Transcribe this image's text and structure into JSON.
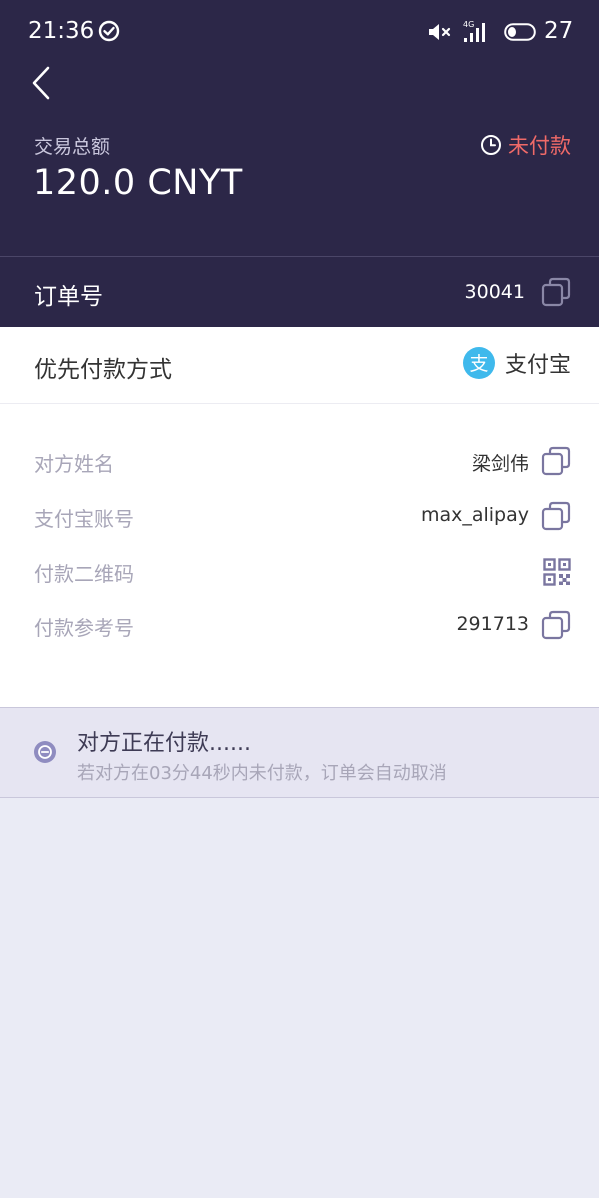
{
  "status_bar": {
    "time": "21:36",
    "battery": "27",
    "network": "4G"
  },
  "header": {
    "total_label": "交易总额",
    "total_amount": "120.0 CNYT",
    "status": "未付款",
    "status_color": "#f06a68",
    "background": "#2c2748"
  },
  "order": {
    "label": "订单号",
    "number": "30041"
  },
  "payment_method": {
    "label": "优先付款方式",
    "name": "支付宝",
    "logo_char": "支",
    "logo_color": "#3fb9ec"
  },
  "details": [
    {
      "label": "对方姓名",
      "value": "梁剑伟",
      "action": "copy-icon"
    },
    {
      "label": "支付宝账号",
      "value": "max_alipay",
      "action": "copy-icon"
    },
    {
      "label": "付款二维码",
      "value": "",
      "action": "qr-code-icon"
    },
    {
      "label": "付款参考号",
      "value": "291713",
      "action": "copy-icon"
    }
  ],
  "notice": {
    "title": "对方正在付款......",
    "subtitle": "若对方在03分44秒内未付款，订单会自动取消"
  }
}
